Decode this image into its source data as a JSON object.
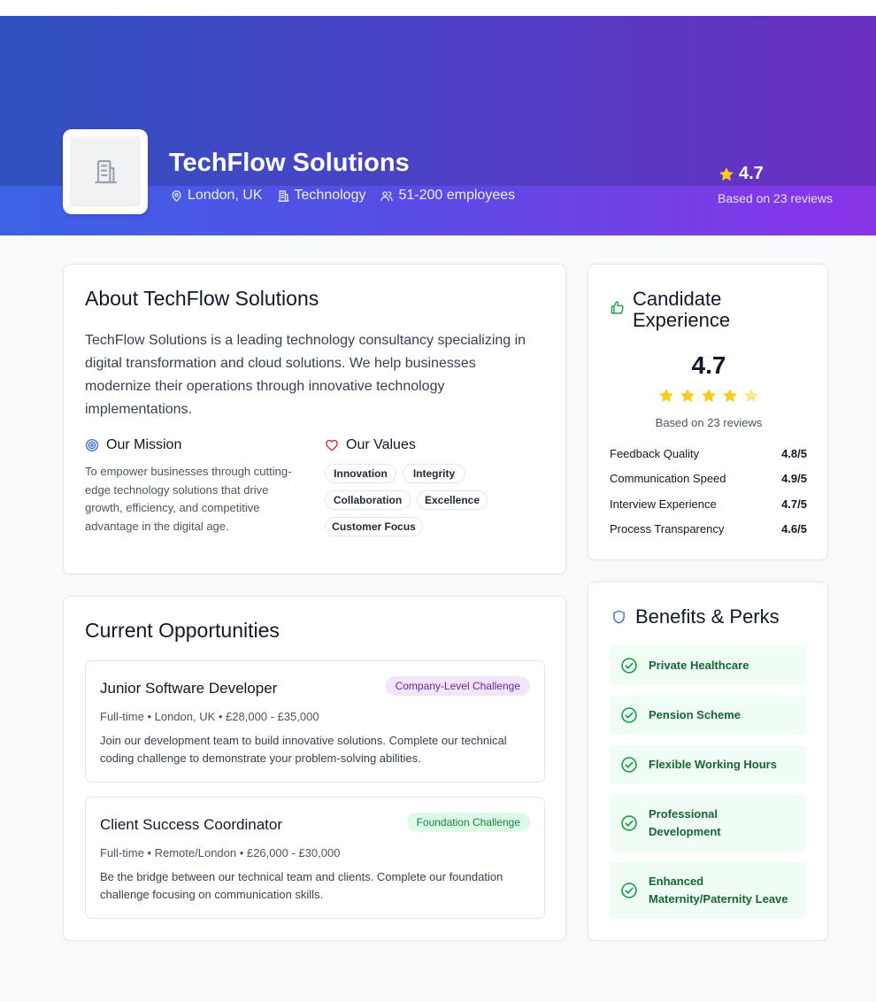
{
  "company": {
    "name": "TechFlow Solutions",
    "location": "London, UK",
    "industry": "Technology",
    "size": "51-200 employees",
    "rating": "4.7",
    "rating_based_on": "Based on 23 reviews",
    "rating_value": 4.7
  },
  "about": {
    "title": "About TechFlow Solutions",
    "description": "TechFlow Solutions is a leading technology consultancy specializing in digital transformation and cloud solutions. We help businesses modernize their operations through innovative technology implementations.",
    "mission_title": "Our Mission",
    "mission_text": "To empower businesses through cutting-edge technology solutions that drive growth, efficiency, and competitive advantage in the digital age.",
    "values_title": "Our Values",
    "values": [
      "Innovation",
      "Integrity",
      "Collaboration",
      "Excellence",
      "Customer Focus"
    ]
  },
  "opportunities": {
    "title": "Current Opportunities",
    "jobs": [
      {
        "title": "Junior Software Developer",
        "badge": "Company-Level Challenge",
        "meta": "Full-time • London, UK • £28,000 - £35,000",
        "description": "Join our development team to build innovative solutions. Complete our technical coding challenge to demonstrate your problem-solving abilities."
      },
      {
        "title": "Client Success Coordinator",
        "badge": "Foundation Challenge",
        "meta": "Full-time • Remote/London • £26,000 - £30,000",
        "description": "Be the bridge between our technical team and clients. Complete our foundation challenge focusing on communication skills."
      }
    ]
  },
  "candidate_experience": {
    "title_line1": "Candidate",
    "title_line2": "Experience",
    "rating": "4.7",
    "stars_filled": 4.7,
    "based_on": "Based on 23 reviews",
    "metrics": [
      {
        "label": "Feedback Quality",
        "value": "4.8/5"
      },
      {
        "label": "Communication Speed",
        "value": "4.9/5"
      },
      {
        "label": "Interview Experience",
        "value": "4.7/5"
      },
      {
        "label": "Process Transparency",
        "value": "4.6/5"
      }
    ]
  },
  "benefits": {
    "title": "Benefits & Perks",
    "items": [
      {
        "line1": "Private Healthcare",
        "line2": ""
      },
      {
        "line1": "Pension Scheme",
        "line2": ""
      },
      {
        "line1": "Flexible Working Hours",
        "line2": ""
      },
      {
        "line1": "Professional",
        "line2": "Development"
      },
      {
        "line1": "Enhanced",
        "line2": "Maternity/Paternity Leave"
      }
    ]
  },
  "colors": {
    "hero_start": "#2f51bf",
    "hero_end": "#6a2fbf",
    "star": "#facc15",
    "green_accent": "#16a34a",
    "purple_badge": "#6b21a8"
  },
  "icons": [
    "building-icon",
    "map-pin-icon",
    "office-icon",
    "users-icon",
    "star-icon",
    "target-icon",
    "heart-icon",
    "thumbs-up-icon",
    "shield-icon",
    "check-circle-icon"
  ]
}
